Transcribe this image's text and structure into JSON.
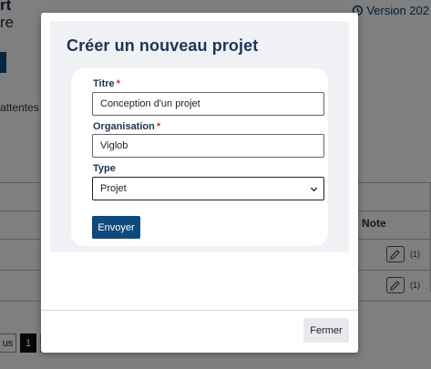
{
  "background": {
    "title_line1": "rt",
    "title_line2": "re",
    "version_label": "Version 202",
    "attentes_text": "attentes (",
    "note_header": "Note",
    "note_rows": [
      {
        "count": "(1)"
      },
      {
        "count": "(1)"
      }
    ],
    "pagination": {
      "prev_label": "us",
      "current_page": "1"
    }
  },
  "modal": {
    "title": "Créer un nouveau projet",
    "fields": {
      "titre": {
        "label": "Titre",
        "value": "Conception d'un projet"
      },
      "organisation": {
        "label": "Organisation",
        "value": "Viglob"
      },
      "type": {
        "label": "Type",
        "selected": "Projet"
      }
    },
    "required_marker": "*",
    "submit_label": "Envoyer",
    "close_label": "Fermer"
  },
  "colors": {
    "primary": "#0e4a7c",
    "heading": "#1d3556",
    "required": "#c0392b"
  }
}
